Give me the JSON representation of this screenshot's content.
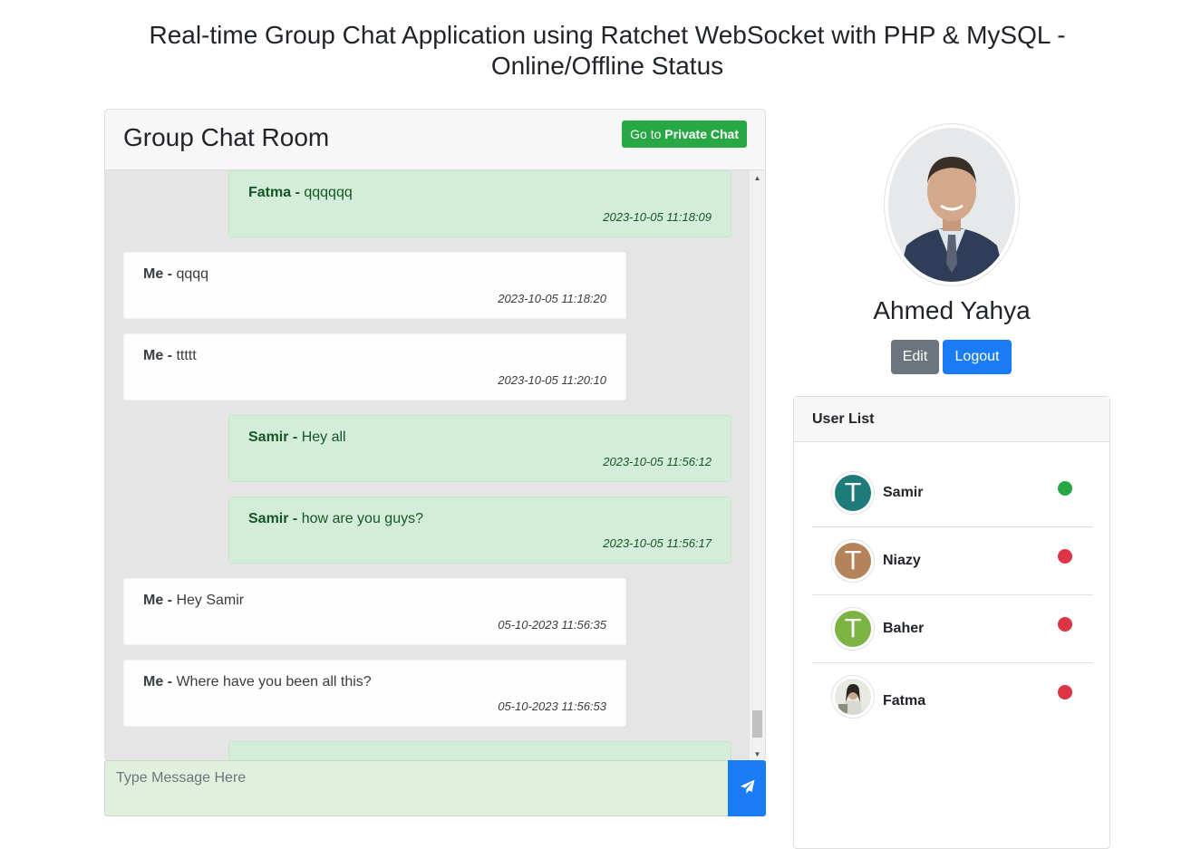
{
  "page": {
    "title": "Real-time Group Chat Application using Ratchet WebSocket with PHP & MySQL - Online/Offline Status"
  },
  "chat": {
    "title": "Group Chat Room",
    "private_button": {
      "prefix": "Go to",
      "bold": "Private Chat"
    },
    "messages": [
      {
        "sender": "Fatma - ",
        "text": "qqqqqq",
        "time": "2023-10-05 11:18:09",
        "type": "other"
      },
      {
        "sender": "Me - ",
        "text": "qqqq",
        "time": "2023-10-05 11:18:20",
        "type": "me"
      },
      {
        "sender": "Me - ",
        "text": "ttttt",
        "time": "2023-10-05 11:20:10",
        "type": "me"
      },
      {
        "sender": "Samir - ",
        "text": "Hey all",
        "time": "2023-10-05 11:56:12",
        "type": "other"
      },
      {
        "sender": "Samir - ",
        "text": "how are you guys?",
        "time": "2023-10-05 11:56:17",
        "type": "other"
      },
      {
        "sender": "Me - ",
        "text": "Hey Samir",
        "time": "05-10-2023 11:56:35",
        "type": "me"
      },
      {
        "sender": "Me - ",
        "text": "Where have you been all this?",
        "time": "05-10-2023 11:56:53",
        "type": "me"
      }
    ],
    "input_placeholder": "Type Message Here",
    "input_value": "",
    "send_icon": "paper-plane-icon"
  },
  "profile": {
    "name": "Ahmed Yahya",
    "edit_label": "Edit",
    "logout_label": "Logout"
  },
  "user_list": {
    "title": "User List",
    "users": [
      {
        "name": "Samir",
        "initial": "T",
        "avatar_color": "#1f7a7a",
        "status": "online",
        "status_color": "#28a745"
      },
      {
        "name": "Niazy",
        "initial": "T",
        "avatar_color": "#b5835a",
        "status": "offline",
        "status_color": "#dc3545"
      },
      {
        "name": "Baher",
        "initial": "T",
        "avatar_color": "#7cb342",
        "status": "offline",
        "status_color": "#dc3545"
      },
      {
        "name": "Fatma",
        "initial": "",
        "avatar_color": "#ffffff",
        "status": "offline",
        "status_color": "#dc3545"
      }
    ]
  }
}
